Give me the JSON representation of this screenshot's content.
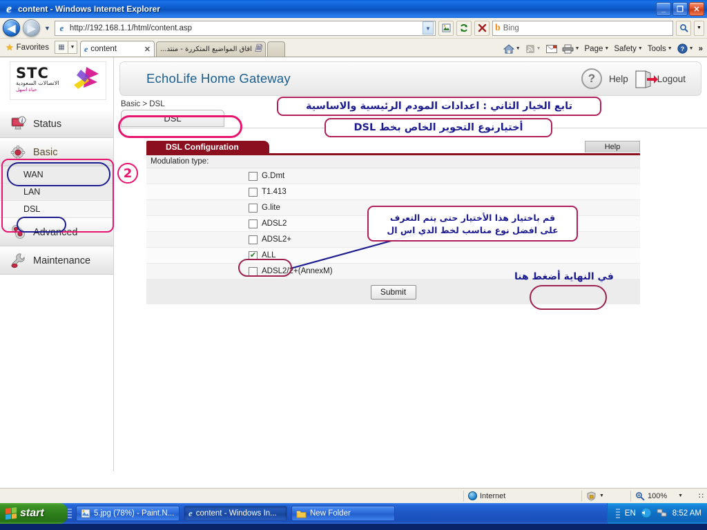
{
  "window": {
    "title": "content - Windows Internet Explorer",
    "icon": "ie-icon",
    "minimize_label": "_",
    "maximize_label": "❐",
    "close_label": "✕"
  },
  "browser": {
    "back_label": "◀",
    "forward_label": "▶",
    "history_caret": "▼",
    "url": "http://192.168.1.1/html/content.asp",
    "url_caret": "▼",
    "toolbar_buttons": [
      {
        "name": "compatibility-view-icon",
        "glyph": "🖼"
      },
      {
        "name": "refresh-icon",
        "glyph": "↻"
      },
      {
        "name": "stop-icon",
        "glyph": "✕"
      }
    ],
    "search": {
      "provider": "Bing",
      "placeholder": "Bing",
      "value": "",
      "go_icon": "search-icon",
      "caret": "▼"
    },
    "favorites_label": "Favorites",
    "tabs": [
      {
        "label": "content",
        "icon": "ie-icon",
        "active": true,
        "close": "✕"
      },
      {
        "label": "آفاق المواضيع المتكررة - منتد...",
        "icon": "page-icon",
        "active": false,
        "close": ""
      }
    ],
    "command_bar": [
      {
        "name": "home-icon",
        "label": "",
        "glyph": "⌂",
        "caret": "▼"
      },
      {
        "name": "feeds-icon",
        "label": "",
        "glyph": "◩",
        "caret": "▼"
      },
      {
        "name": "mail-icon",
        "label": "",
        "glyph": "✉",
        "caret": ""
      },
      {
        "name": "print-icon",
        "label": "",
        "glyph": "⎙",
        "caret": "▼"
      },
      {
        "name": "page-menu",
        "label": "Page",
        "glyph": "",
        "caret": "▼"
      },
      {
        "name": "safety-menu",
        "label": "Safety",
        "glyph": "",
        "caret": "▼"
      },
      {
        "name": "tools-menu",
        "label": "Tools",
        "glyph": "",
        "caret": "▼"
      },
      {
        "name": "help-menu",
        "label": "",
        "glyph": "?",
        "caret": "▼"
      }
    ],
    "overflow_label": "»"
  },
  "router": {
    "logo": {
      "brand": "STC",
      "arabic_name": "الاتصالات السعودية",
      "tagline": "حياة اسهل"
    },
    "header": {
      "title": "EchoLife Home Gateway",
      "help_label": "Help",
      "logout_label": "Logout"
    },
    "breadcrumb": "Basic > DSL",
    "active_tab": "DSL",
    "sidebar": [
      {
        "label": "Status",
        "icon": "monitor-info-icon",
        "type": "top"
      },
      {
        "label": "Basic",
        "icon": "gear-icon",
        "type": "top",
        "selected": true
      },
      {
        "label": "WAN",
        "icon": "",
        "type": "sub"
      },
      {
        "label": "LAN",
        "icon": "",
        "type": "sub"
      },
      {
        "label": "DSL",
        "icon": "",
        "type": "sub",
        "selected": true
      },
      {
        "label": "Advanced",
        "icon": "gears-icon",
        "type": "top"
      },
      {
        "label": "Maintenance",
        "icon": "wrench-icon",
        "type": "top"
      }
    ],
    "panel": {
      "title": "DSL Configuration",
      "help_label": "Help",
      "section_label": "Modulation type:",
      "options": [
        {
          "label": "G.Dmt",
          "checked": false
        },
        {
          "label": "T1.413",
          "checked": false
        },
        {
          "label": "G.lite",
          "checked": false
        },
        {
          "label": "ADSL2",
          "checked": false
        },
        {
          "label": "ADSL2+",
          "checked": false
        },
        {
          "label": "ALL",
          "checked": true
        },
        {
          "label": "ADSL2/2+(AnnexM)",
          "checked": false
        }
      ],
      "check_glyph": "✔",
      "submit_label": "Submit"
    }
  },
  "annotations": {
    "step_number": "2",
    "title_line1": "تابع الخيار الثاني : اعدادات المودم الرئيسية والاساسية",
    "title_line2": "أختيارنوع التحوير الخاص بخط DSL",
    "note_line1": "قم باختيار هذا الأختيار حتى يتم التعرف",
    "note_line2": "على افضل نوع مناسب لخط الدي اس ال",
    "submit_note": "في النهاية أضغط هنا",
    "colors": {
      "pink": "#e8136f",
      "maroon": "#b01e5a",
      "navy": "#1b1b8f"
    }
  },
  "statusbar": {
    "zone_label": "Internet",
    "protected_mode_icon": "shield-icon",
    "zoom_label": "100%",
    "zoom_icon": "magnifier-icon",
    "caret": "▼"
  },
  "taskbar": {
    "start_label": "start",
    "items": [
      {
        "label": "5.jpg (78%) - Paint.N...",
        "icon": "paint-icon"
      },
      {
        "label": "content - Windows In...",
        "icon": "ie-icon",
        "active": true
      },
      {
        "label": "New Folder",
        "icon": "folder-icon"
      }
    ],
    "tray": {
      "language": "EN",
      "icons": [
        "volume-icon",
        "network-icon"
      ],
      "clock": "8:52 AM"
    }
  }
}
